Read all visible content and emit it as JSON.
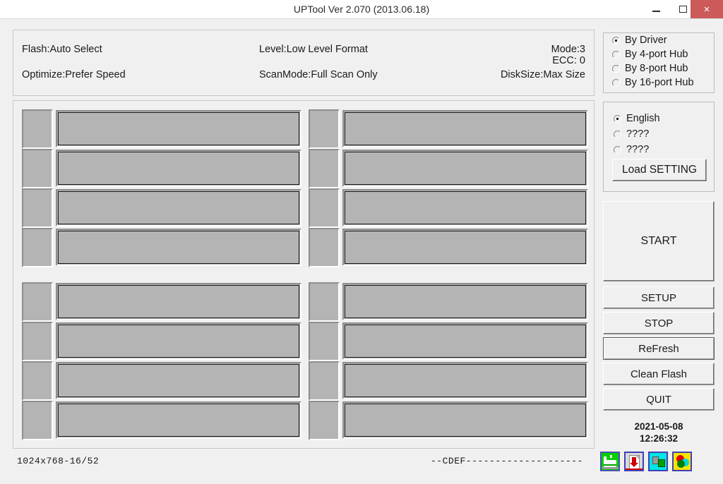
{
  "window": {
    "title": "UPTool Ver 2.070 (2013.06.18)",
    "minimize_label": "–",
    "maximize_label": "□",
    "close_label": "×",
    "close_bg": "#cc5a5a"
  },
  "info": {
    "flash": "Flash:Auto Select",
    "level": "Level:Low Level Format",
    "mode": "Mode:3",
    "ecc": "ECC: 0",
    "optimize": "Optimize:Prefer Speed",
    "scanmode": "ScanMode:Full Scan Only",
    "disksize": "DiskSize:Max Size"
  },
  "connection": {
    "options": [
      {
        "label": "By Driver",
        "selected": true
      },
      {
        "label": "By 4-port Hub",
        "selected": false
      },
      {
        "label": "By 8-port Hub",
        "selected": false
      },
      {
        "label": "By 16-port Hub",
        "selected": false
      }
    ]
  },
  "language": {
    "options": [
      {
        "label": "English",
        "selected": true
      },
      {
        "label": "????",
        "selected": false
      },
      {
        "label": "????",
        "selected": false
      }
    ],
    "load_setting_label": "Load SETTING"
  },
  "actions": {
    "start": "START",
    "setup": "SETUP",
    "stop": "STOP",
    "refresh": "ReFresh",
    "clean_flash": "Clean Flash",
    "quit": "QUIT"
  },
  "clock": {
    "date": "2021-05-08",
    "time": "12:26:32"
  },
  "tray_icons": [
    {
      "name": "factory-icon"
    },
    {
      "name": "download-document-icon"
    },
    {
      "name": "flash-chip-icon"
    },
    {
      "name": "color-circles-icon"
    }
  ],
  "devices": {
    "columns": [
      {
        "groups": [
          {
            "rows": [
              {
                "id": "slot-1"
              },
              {
                "id": "slot-2"
              },
              {
                "id": "slot-3"
              },
              {
                "id": "slot-4"
              }
            ]
          },
          {
            "rows": [
              {
                "id": "slot-9"
              },
              {
                "id": "slot-10"
              },
              {
                "id": "slot-11"
              },
              {
                "id": "slot-12"
              }
            ]
          }
        ]
      },
      {
        "groups": [
          {
            "rows": [
              {
                "id": "slot-5"
              },
              {
                "id": "slot-6"
              },
              {
                "id": "slot-7"
              },
              {
                "id": "slot-8"
              }
            ]
          },
          {
            "rows": [
              {
                "id": "slot-13"
              },
              {
                "id": "slot-14"
              },
              {
                "id": "slot-15"
              },
              {
                "id": "slot-16"
              }
            ]
          }
        ]
      }
    ]
  },
  "status": {
    "left": "1024x768-16/52",
    "right": "--CDEF--------------------"
  }
}
